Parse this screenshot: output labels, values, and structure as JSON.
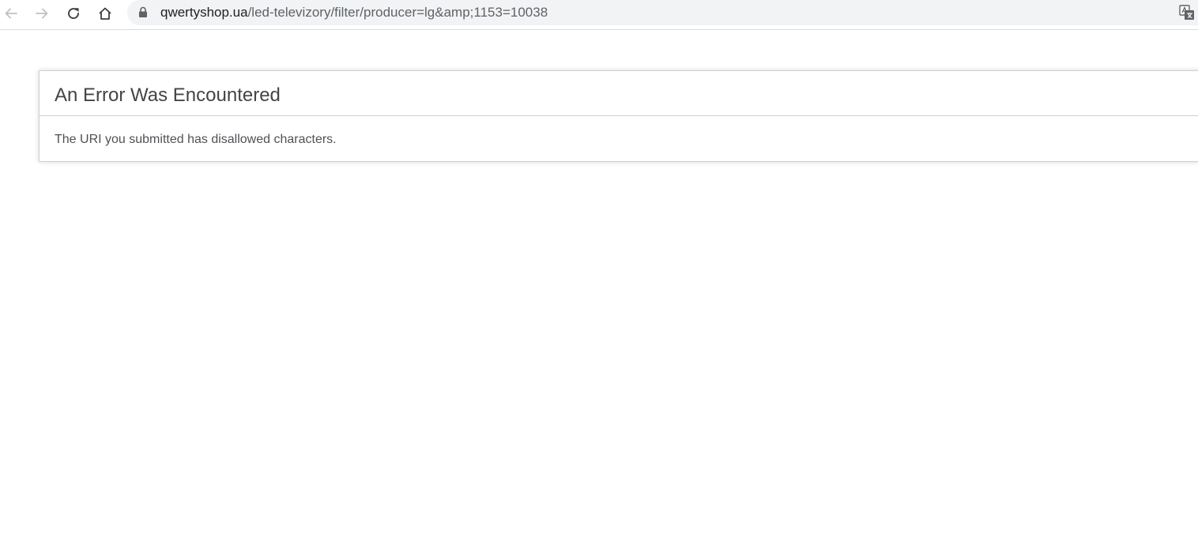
{
  "browser": {
    "url_host": "qwertyshop.ua",
    "url_path": "/led-televizory/filter/producer=lg&amp;1153=10038",
    "icons": {
      "back": "back-arrow-icon",
      "forward": "forward-arrow-icon",
      "reload": "reload-icon",
      "home": "home-icon",
      "lock": "lock-icon",
      "translate": "translate-icon"
    },
    "colors": {
      "omnibox_bg": "#f1f3f4",
      "icon": "#5f6368"
    }
  },
  "error": {
    "title": "An Error Was Encountered",
    "message": "The URI you submitted has disallowed characters."
  }
}
